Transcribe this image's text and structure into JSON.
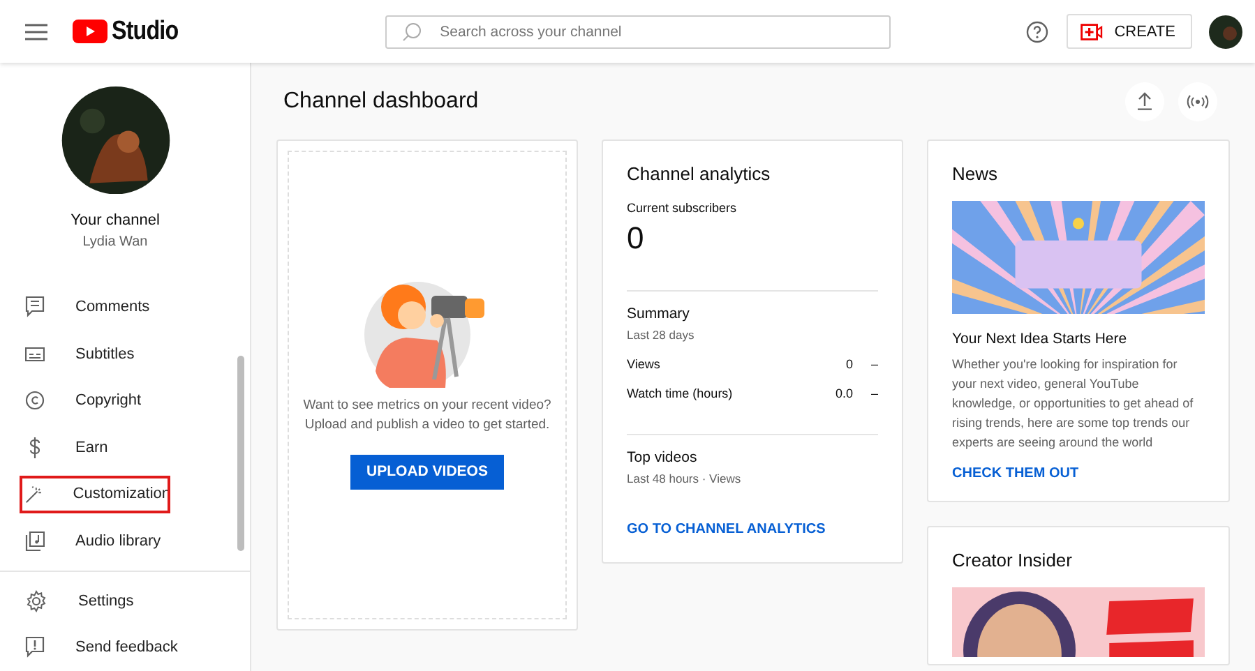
{
  "header": {
    "logo_text": "Studio",
    "search": {
      "placeholder": "Search across your channel"
    },
    "create_button": "CREATE"
  },
  "sidebar": {
    "channel_label": "Your channel",
    "channel_name": "Lydia Wan",
    "items": [
      {
        "label": "Comments",
        "highlighted": false
      },
      {
        "label": "Subtitles",
        "highlighted": false
      },
      {
        "label": "Copyright",
        "highlighted": false
      },
      {
        "label": "Earn",
        "highlighted": false
      },
      {
        "label": "Customization",
        "highlighted": true
      },
      {
        "label": "Audio library",
        "highlighted": false
      }
    ],
    "footer_items": [
      {
        "label": "Settings"
      },
      {
        "label": "Send feedback"
      }
    ]
  },
  "page_title": "Channel dashboard",
  "upload_card": {
    "text": "Want to see metrics on your recent video? Upload and publish a video to get started.",
    "button": "UPLOAD VIDEOS"
  },
  "analytics": {
    "title": "Channel analytics",
    "subscribers_label": "Current subscribers",
    "subscribers": "0",
    "summary_title": "Summary",
    "summary_period": "Last 28 days",
    "metrics": [
      {
        "label": "Views",
        "value": "0",
        "trend": "–"
      },
      {
        "label": "Watch time (hours)",
        "value": "0.0",
        "trend": "–"
      }
    ],
    "top_videos_title": "Top videos",
    "top_videos_period": "Last 48 hours · Views",
    "link": "GO TO CHANNEL ANALYTICS"
  },
  "news": {
    "title": "News",
    "headline": "Your Next Idea Starts Here",
    "body": "Whether you're looking for inspiration for your next video, general YouTube knowledge, or opportunities to get ahead of rising trends, here are some top trends our experts are seeing around the world",
    "link": "CHECK THEM OUT"
  },
  "creator_insider": {
    "title": "Creator Insider"
  }
}
